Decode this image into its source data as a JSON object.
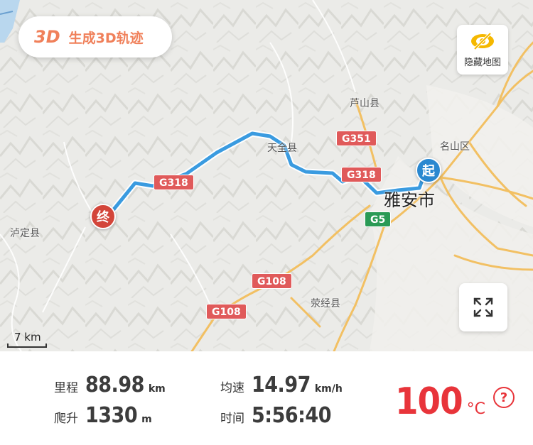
{
  "map": {
    "generate_3d": {
      "badge": "3D",
      "label": "生成3D轨迹"
    },
    "hide_map": {
      "label": "隐藏地图"
    },
    "scale": {
      "label": "7 km"
    },
    "places": {
      "lushan": "芦山县",
      "tianquan": "天全县",
      "mingshan": "名山区",
      "yaan": "雅安市",
      "luding": "泸定县",
      "yingjing": "荥经县"
    },
    "roads": {
      "g351": "G351",
      "g318_east": "G318",
      "g318_west": "G318",
      "g5": "G5",
      "g108_north": "G108",
      "g108_south": "G108"
    },
    "markers": {
      "start": "起",
      "end": "终"
    },
    "colors": {
      "track": "#3a9be0",
      "start": "#2a88d0",
      "end": "#d3453a",
      "road": "#f2c063"
    }
  },
  "stats": {
    "distance": {
      "label": "里程",
      "value": "88.98",
      "unit": "km"
    },
    "avg_speed": {
      "label": "均速",
      "value": "14.97",
      "unit": "km/h"
    },
    "climb": {
      "label": "爬升",
      "value": "1330",
      "unit": "m"
    },
    "time": {
      "label": "时间",
      "value": "5:56:40"
    },
    "temperature": {
      "value": "100",
      "unit": "°C"
    },
    "help": "?"
  }
}
